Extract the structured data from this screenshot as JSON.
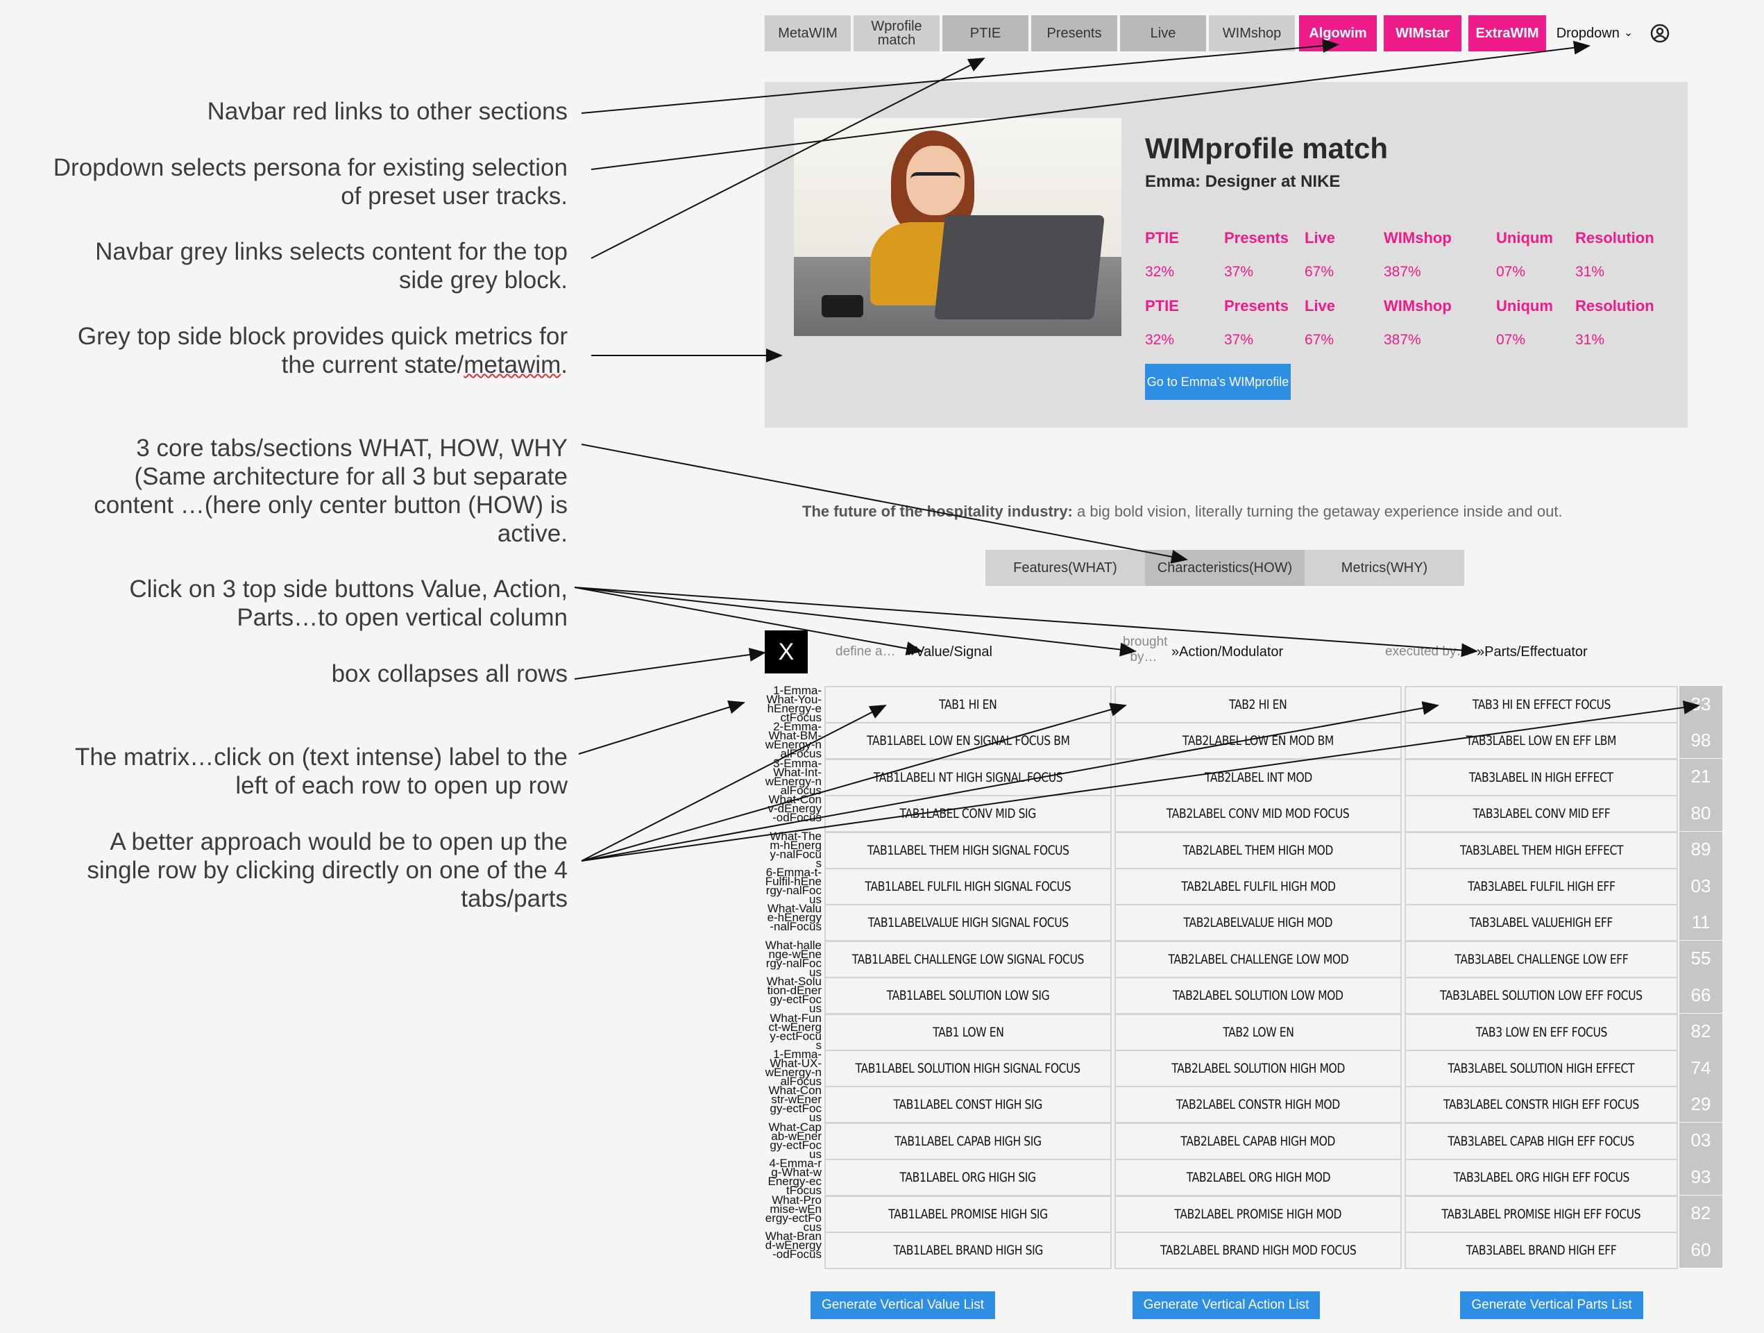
{
  "nav": {
    "tabs": [
      {
        "label": "MetaWIM",
        "style": "grey"
      },
      {
        "label": "Wprofile match",
        "style": "grey"
      },
      {
        "label": "PTIE",
        "style": "dark"
      },
      {
        "label": "Presents",
        "style": "dark"
      },
      {
        "label": "Live",
        "style": "dark"
      },
      {
        "label": "WIMshop",
        "style": "grey"
      }
    ],
    "red_links": [
      "Algowim",
      "WIMstar",
      "ExtraWIM"
    ],
    "dropdown_label": "Dropdown",
    "user_icon": "user-circle-icon"
  },
  "profile": {
    "title": "WIMprofile match",
    "subtitle": "Emma: Designer at NIKE",
    "image": "woman-with-laptop-photo",
    "metric_rows": [
      {
        "headers": [
          "PTIE",
          "Presents",
          "Live",
          "WIMshop",
          "Uniqum",
          "Resolution"
        ],
        "values": [
          "32%",
          "37%",
          "67%",
          "387%",
          "07%",
          "31%"
        ]
      },
      {
        "headers": [
          "PTIE",
          "Presents",
          "Live",
          "WIMshop",
          "Uniqum",
          "Resolution"
        ],
        "values": [
          "32%",
          "37%",
          "67%",
          "387%",
          "07%",
          "31%"
        ]
      }
    ],
    "button_label": "Go to Emma's WIMprofile",
    "accent_color": "#ee1b8b",
    "button_color": "#2d8ee4"
  },
  "annotations": {
    "red_links": "Navbar red links to other sections",
    "dropdown_1": "Dropdown selects persona for existing selection",
    "dropdown_2": "of preset user tracks.",
    "grey_links_1": "Navbar grey links selects content for the top",
    "grey_links_2": "side grey block.",
    "grey_block_1": "Grey top side block provides  quick metrics for",
    "grey_block_2": "the current state/",
    "grey_block_3": "metawim",
    "grey_block_4": ".",
    "core_tabs_1": "3 core tabs/sections WHAT, HOW, WHY",
    "core_tabs_2": "(Same  architecture for all 3 but separate",
    "core_tabs_3": "content …(here only center button (HOW) is",
    "core_tabs_4": "active.",
    "top_buttons_1": "Click on 3 top side buttons Value, Action,",
    "top_buttons_2": "Parts…to open vertical column",
    "box": "box collapses all rows",
    "matrix_1": "The matrix…click on (text intense) label to the",
    "matrix_2": "left of each row to open up row",
    "better_1": "A better approach would be to open up the",
    "better_2": "single row by clicking directly on one of the 4",
    "better_3": "tabs/parts"
  },
  "headline": {
    "bold": "The future of the hospitality industry:",
    "rest": " a big bold vision, literally turning the getaway experience inside and out."
  },
  "core_tabs": [
    "Features(WHAT)",
    "Characteristics(HOW)",
    "Metrics(WHY)"
  ],
  "active_core_tab": "Characteristics(HOW)",
  "close_box": "X",
  "columns": [
    {
      "prefix": "define a…",
      "label": "»Value/Signal"
    },
    {
      "prefix": "brought by…",
      "label": "»Action/Modulator"
    },
    {
      "prefix": "executed by…",
      "label": "»Parts/Effectuator"
    }
  ],
  "matrix_rows": [
    {
      "label": "1-Emma-What-You-hEnergy-ectFocus",
      "cells": [
        "TAB1 HI EN",
        "TAB2 HI EN",
        "TAB3 HI EN EFFECT FOCUS"
      ],
      "num": "33"
    },
    {
      "label": "2-Emma-What-BM-wEnergy-nalFocus",
      "cells": [
        "TAB1LABEL LOW EN SIGNAL FOCUS BM",
        "TAB2LABEL LOW EN MOD BM",
        "TAB3LABEL LOW EN EFF LBM"
      ],
      "num": "98"
    },
    {
      "label": "3-Emma-What-Int-wEnergy-nalFocus",
      "cells": [
        "TAB1LABELI NT HIGH SIGNAL FOCUS",
        "TAB2LABEL INT MOD",
        "TAB3LABEL IN HIGH EFFECT"
      ],
      "num": "21"
    },
    {
      "label": "What-Conv-dEnergy-odFocus",
      "cells": [
        "TAB1LABEL CONV MID SIG",
        "TAB2LABEL CONV MID MOD FOCUS",
        "TAB3LABEL CONV MID EFF"
      ],
      "num": "80"
    },
    {
      "label": "What-Them-hEnergy-nalFocus",
      "cells": [
        "TAB1LABEL THEM HIGH SIGNAL FOCUS",
        "TAB2LABEL THEM HIGH MOD",
        "TAB3LABEL THEM HIGH EFFECT"
      ],
      "num": "89"
    },
    {
      "label": "6-Emma-t-Fulfil-hEnergy-nalFocus",
      "cells": [
        "TAB1LABEL FULFIL HIGH SIGNAL FOCUS",
        "TAB2LABEL FULFIL HIGH MOD",
        "TAB3LABEL FULFIL HIGH EFF"
      ],
      "num": "03"
    },
    {
      "label": "What-Value-hEnergy-nalFocus",
      "cells": [
        "TAB1LABELVALUE HIGH SIGNAL FOCUS",
        "TAB2LABELVALUE HIGH MOD",
        "TAB3LABEL VALUEHIGH EFF"
      ],
      "num": "11"
    },
    {
      "label": "What-hallenge-wEnergy-nalFocus",
      "cells": [
        "TAB1LABEL CHALLENGE LOW SIGNAL FOCUS",
        "TAB2LABEL CHALLENGE LOW MOD",
        "TAB3LABEL CHALLENGE LOW EFF"
      ],
      "num": "55"
    },
    {
      "label": "What-Solution-dEnergy-ectFocus",
      "cells": [
        "TAB1LABEL SOLUTION LOW SIG",
        "TAB2LABEL SOLUTION LOW MOD",
        "TAB3LABEL SOLUTION LOW EFF FOCUS"
      ],
      "num": "66"
    },
    {
      "label": "What-Funct-wEnergy-ectFocus",
      "cells": [
        "TAB1 LOW EN",
        "TAB2 LOW EN",
        "TAB3 LOW EN EFF FOCUS"
      ],
      "num": "82"
    },
    {
      "label": "1-Emma-What-UX-wEnergy-nalFocus",
      "cells": [
        "TAB1LABEL SOLUTION HIGH SIGNAL FOCUS",
        "TAB2LABEL SOLUTION HIGH MOD",
        "TAB3LABEL SOLUTION HIGH EFFECT"
      ],
      "num": "74"
    },
    {
      "label": "What-Constr-wEnergy-ectFocus",
      "cells": [
        "TAB1LABEL CONST HIGH SIG",
        "TAB2LABEL CONSTR HIGH MOD",
        "TAB3LABEL CONSTR HIGH EFF FOCUS"
      ],
      "num": "29"
    },
    {
      "label": "What-Capab-wEnergy-ectFocus",
      "cells": [
        "TAB1LABEL CAPAB HIGH SIG",
        "TAB2LABEL CAPAB HIGH MOD",
        "TAB3LABEL CAPAB HIGH EFF FOCUS"
      ],
      "num": "03"
    },
    {
      "label": "4-Emma-rg-What-wEnergy-ectFocus",
      "cells": [
        "TAB1LABEL ORG HIGH SIG",
        "TAB2LABEL ORG HIGH MOD",
        "TAB3LABEL ORG HIGH EFF FOCUS"
      ],
      "num": "93"
    },
    {
      "label": "What-Promise-wEnergy-ectFocus",
      "cells": [
        "TAB1LABEL PROMISE HIGH SIG",
        "TAB2LABEL PROMISE HIGH MOD",
        "TAB3LABEL PROMISE HIGH EFF FOCUS"
      ],
      "num": "82"
    },
    {
      "label": "What-Brand-wEnergy-odFocus",
      "cells": [
        "TAB1LABEL BRAND HIGH SIG",
        "TAB2LABEL BRAND HIGH MOD FOCUS",
        "TAB3LABEL BRAND HIGH EFF"
      ],
      "num": "60"
    }
  ],
  "generate_buttons": [
    "Generate Vertical Value List",
    "Generate Vertical Action List",
    "Generate Vertical Parts List"
  ]
}
